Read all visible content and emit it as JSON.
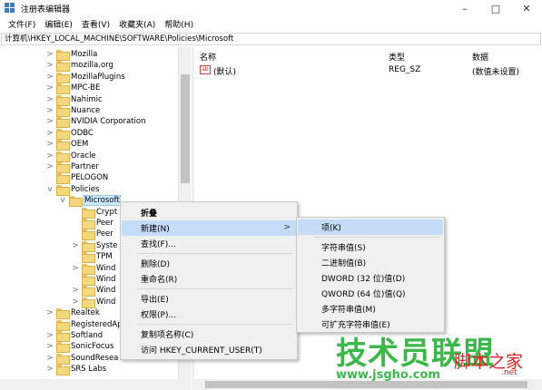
{
  "window": {
    "title": "注册表编辑器",
    "minimize": "–",
    "maximize": "□",
    "close": "✕"
  },
  "menu": [
    "文件(F)",
    "编辑(E)",
    "查看(V)",
    "收藏夹(A)",
    "帮助(H)"
  ],
  "address": "计算机\\HKEY_LOCAL_MACHINE\\SOFTWARE\\Policies\\Microsoft",
  "tree": [
    {
      "label": "Mozilla",
      "depth": 0,
      "chevron": ">"
    },
    {
      "label": "mozilla.org",
      "depth": 0,
      "chevron": ">"
    },
    {
      "label": "MozillaPlugins",
      "depth": 0,
      "chevron": ">"
    },
    {
      "label": "MPC-BE",
      "depth": 0,
      "chevron": ">"
    },
    {
      "label": "Nahimic",
      "depth": 0,
      "chevron": ">"
    },
    {
      "label": "Nuance",
      "depth": 0,
      "chevron": ">"
    },
    {
      "label": "NVIDIA Corporation",
      "depth": 0,
      "chevron": ">"
    },
    {
      "label": "ODBC",
      "depth": 0,
      "chevron": ">"
    },
    {
      "label": "OEM",
      "depth": 0,
      "chevron": ">"
    },
    {
      "label": "Oracle",
      "depth": 0,
      "chevron": ">"
    },
    {
      "label": "Partner",
      "depth": 0,
      "chevron": ">"
    },
    {
      "label": "PELOGON",
      "depth": 0,
      "chevron": ""
    },
    {
      "label": "Policies",
      "depth": 0,
      "chevron": "v"
    },
    {
      "label": "Microsoft",
      "depth": 1,
      "chevron": "v"
    },
    {
      "label": "Crypt",
      "depth": 2,
      "chevron": ""
    },
    {
      "label": "Peer",
      "depth": 2,
      "chevron": ""
    },
    {
      "label": "Peer",
      "depth": 2,
      "chevron": ""
    },
    {
      "label": "Syste",
      "depth": 2,
      "chevron": ">"
    },
    {
      "label": "TPM",
      "depth": 2,
      "chevron": ""
    },
    {
      "label": "Wind",
      "depth": 2,
      "chevron": ">"
    },
    {
      "label": "Wind",
      "depth": 2,
      "chevron": ""
    },
    {
      "label": "Wind",
      "depth": 2,
      "chevron": ">"
    },
    {
      "label": "Wind",
      "depth": 2,
      "chevron": ">"
    },
    {
      "label": "Realtek",
      "depth": 0,
      "chevron": ">"
    },
    {
      "label": "RegisteredAp",
      "depth": 0,
      "chevron": ""
    },
    {
      "label": "Softland",
      "depth": 0,
      "chevron": ">"
    },
    {
      "label": "SonicFocus",
      "depth": 0,
      "chevron": ">"
    },
    {
      "label": "SoundResea",
      "depth": 0,
      "chevron": ">"
    },
    {
      "label": "SRS Labs",
      "depth": 0,
      "chevron": ">"
    }
  ],
  "list": {
    "columns": [
      "名称",
      "类型",
      "数据"
    ],
    "rows": [
      {
        "icon": "ab",
        "name": "(默认)",
        "type": "REG_SZ",
        "data": "(数值未设置)"
      }
    ]
  },
  "context_menu": {
    "items": [
      "折叠",
      "新建(N)",
      "查找(F)...",
      "删除(D)",
      "重命名(R)",
      "导出(E)",
      "权限(P)...",
      "复制项名称(C)",
      "访问 HKEY_CURRENT_USER(T)"
    ],
    "arrow": ">"
  },
  "submenu": {
    "items": [
      "项(K)",
      "字符串值(S)",
      "二进制值(B)",
      "DWORD (32 位)值(D)",
      "QWORD (64 位)值(Q)",
      "多字符串值(M)",
      "可扩充字符串值(E)"
    ]
  },
  "watermark": {
    "main": "技术员联盟",
    "url": "www.jsgho.com",
    "extra": "脚本之家",
    "net": ".net"
  },
  "colors": {
    "selection": "#cce8ff",
    "menu_highlight": "#c4dcf6",
    "watermark_green": "#3cb84a",
    "folder": "#f5d77e"
  }
}
